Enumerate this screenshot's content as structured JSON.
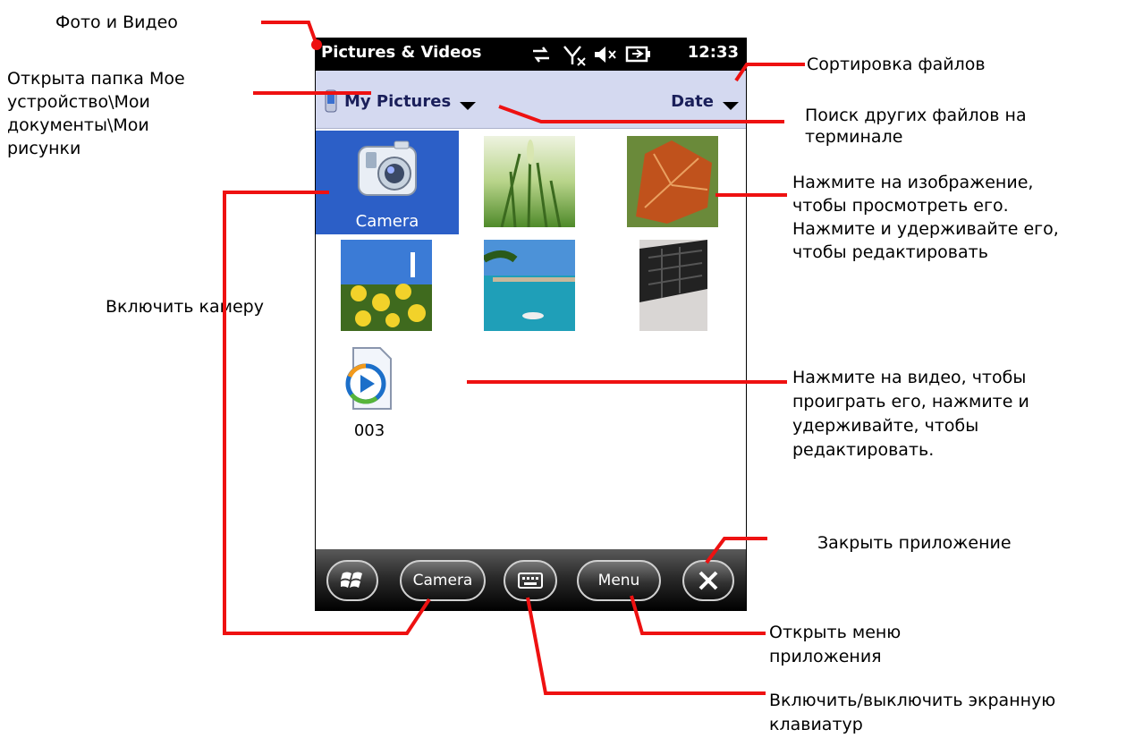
{
  "annotations": {
    "photo_video": "Фото и Видео",
    "folder_open": "Открыта папка Мое\nустройство\\Мои\nдокументы\\Мои\nрисунки",
    "enable_camera": "Включить камеру",
    "sort_files": "Сортировка файлов",
    "search_files": "Поиск других файлов на\nтерминале",
    "tap_image": "Нажмите на изображение,\nчтобы просмотреть его.\nНажмите и удерживайте его,\nчтобы редактировать",
    "tap_video": "Нажмите на видео, чтобы\nпроиграть его, нажмите и\nудерживайте, чтобы\nредактировать.",
    "close_app": "Закрыть приложение",
    "open_menu": "Открыть меню\nприложения",
    "toggle_keyboard": "Включить/выключить экранную\nклавиатур"
  },
  "statusbar": {
    "title": "Pictures & Videos",
    "time": "12:33",
    "icons": [
      "sync-icon",
      "no-signal-icon",
      "volume-muted-icon",
      "battery-charging-icon"
    ]
  },
  "folderbar": {
    "folder": "My Pictures",
    "sort": "Date"
  },
  "grid": {
    "camera_label": "Camera",
    "video_label": "003"
  },
  "bottombar": {
    "camera_button": "Camera",
    "menu_button": "Menu"
  }
}
